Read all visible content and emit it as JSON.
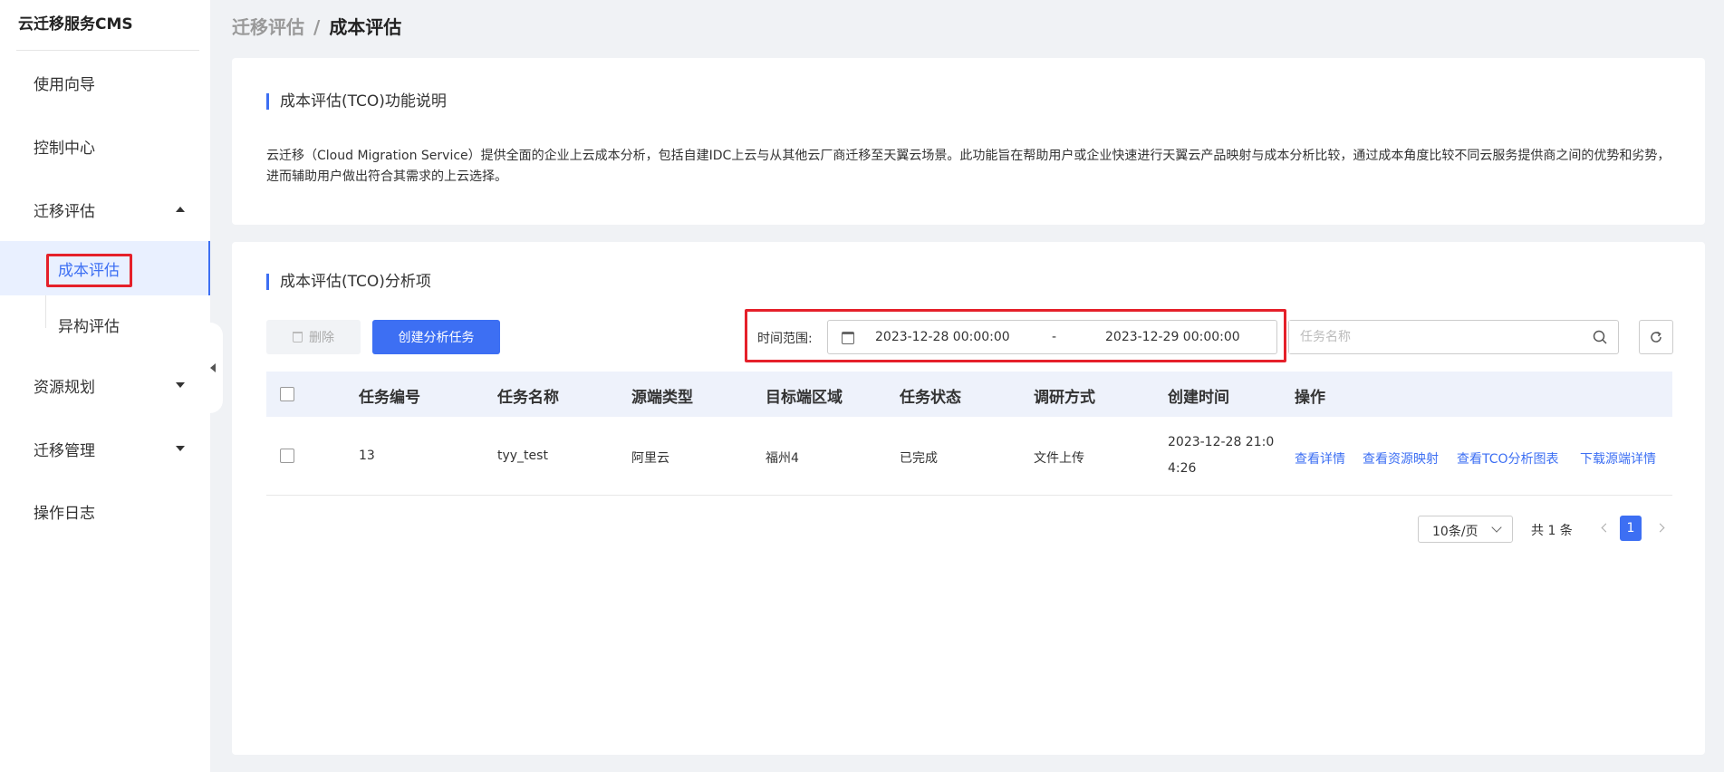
{
  "app": {
    "title": "云迁移服务CMS"
  },
  "sidebar": {
    "items": [
      {
        "label": "使用向导"
      },
      {
        "label": "控制中心"
      },
      {
        "label": "迁移评估"
      },
      {
        "label": "资源规划"
      },
      {
        "label": "迁移管理"
      },
      {
        "label": "操作日志"
      }
    ],
    "sub_items": [
      {
        "label": "成本评估",
        "active": true
      },
      {
        "label": "异构评估",
        "active": false
      }
    ]
  },
  "breadcrumb": {
    "parent": "迁移评估",
    "separator": "/",
    "current": "成本评估"
  },
  "intro": {
    "title": "成本评估(TCO)功能说明",
    "description": "云迁移（Cloud Migration Service）提供全面的企业上云成本分析，包括自建IDC上云与从其他云厂商迁移至天翼云场景。此功能旨在帮助用户或企业快速进行天翼云产品映射与成本分析比较，通过成本角度比较不同云服务提供商之间的优势和劣势，进而辅助用户做出符合其需求的上云选择。"
  },
  "analysis": {
    "title": "成本评估(TCO)分析项",
    "delete_label": "删除",
    "create_label": "创建分析任务",
    "time_range_label": "时间范围:",
    "start_date": "2023-12-28 00:00:00",
    "date_separator": "-",
    "end_date": "2023-12-29 00:00:00",
    "search_placeholder": "任务名称"
  },
  "table": {
    "columns": [
      "任务编号",
      "任务名称",
      "源端类型",
      "目标端区域",
      "任务状态",
      "调研方式",
      "创建时间",
      "操作"
    ],
    "rows": [
      {
        "id": "13",
        "name": "tyy_test",
        "source_type": "阿里云",
        "target_region": "福州4",
        "status": "已完成",
        "survey_method": "文件上传",
        "created_line1": "2023-12-28 21:0",
        "created_line2": "4:26",
        "actions": [
          "查看详情",
          "查看资源映射",
          "查看TCO分析图表",
          "下载源端详情"
        ]
      }
    ]
  },
  "pagination": {
    "page_size": "10条/页",
    "total": "共 1 条",
    "current_page": "1"
  },
  "colors": {
    "accent": "#3d6ff3",
    "highlight": "#e5202a"
  }
}
